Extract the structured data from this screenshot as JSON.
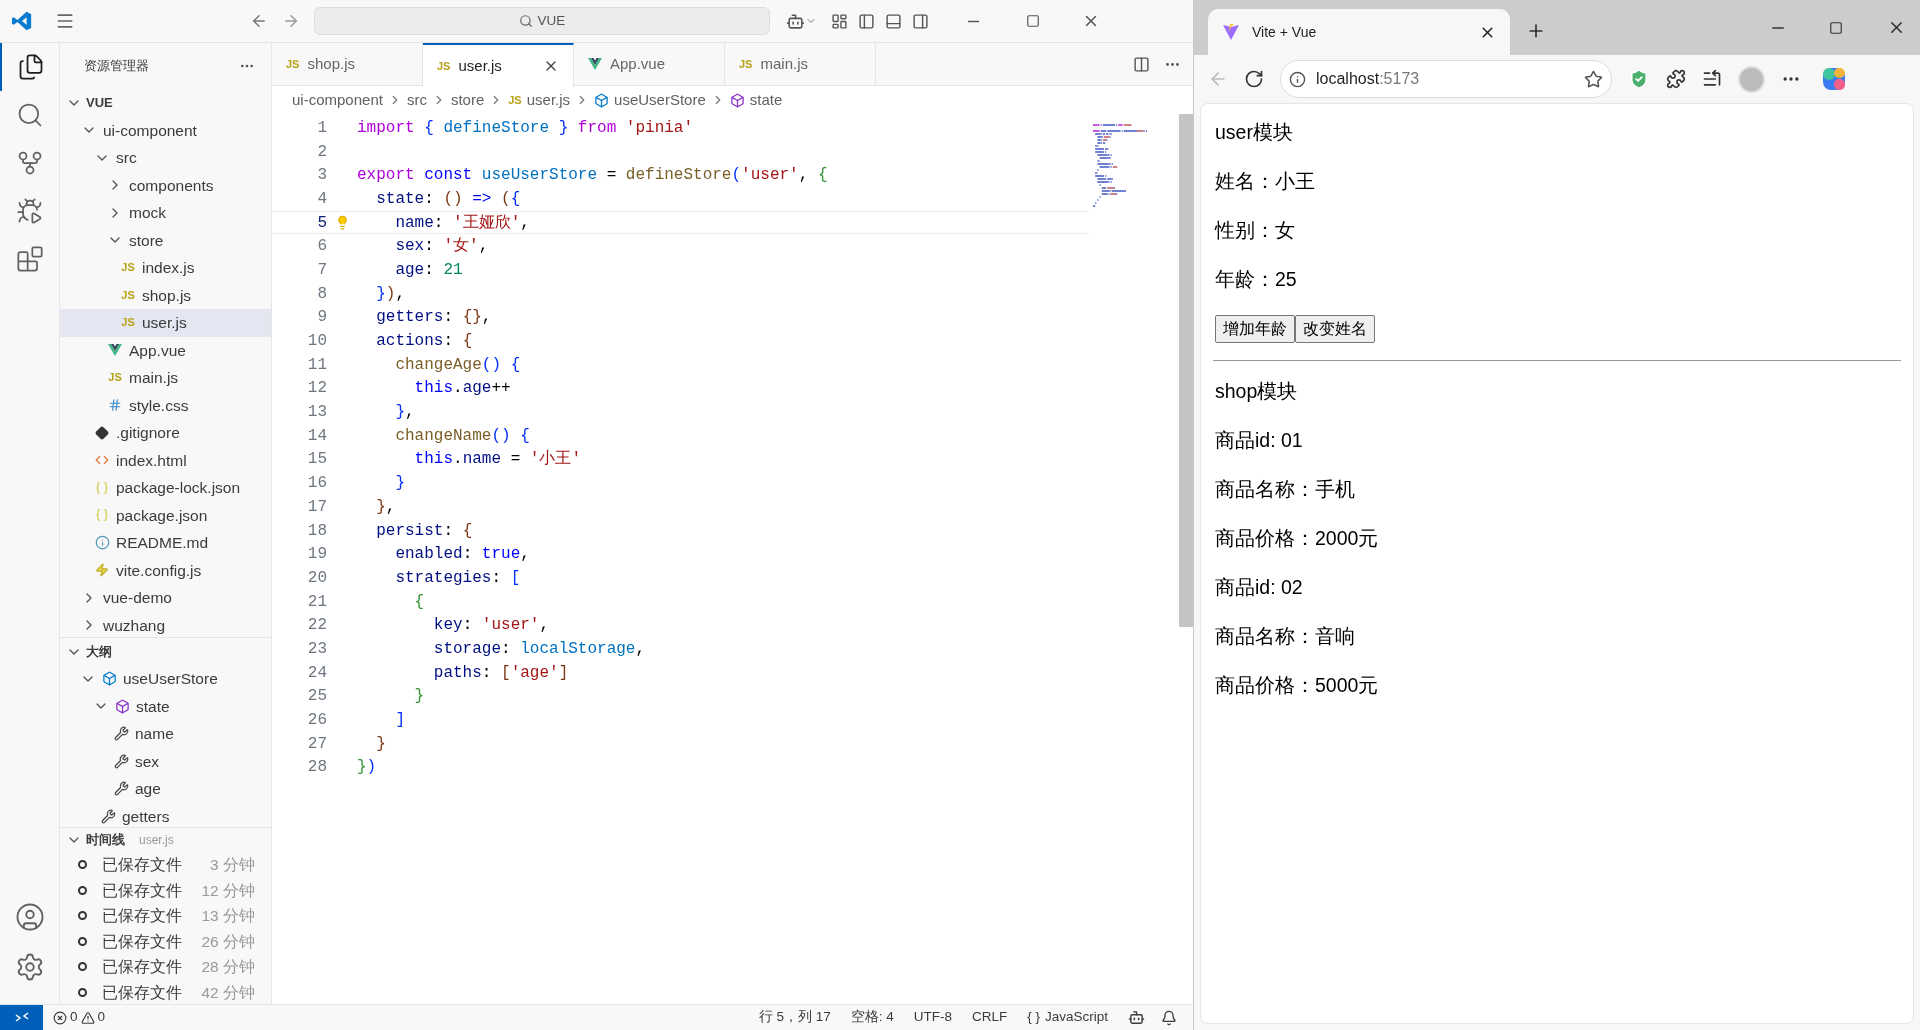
{
  "vscode": {
    "title_search": "VUE",
    "explorer": {
      "title": "资源管理器",
      "root": {
        "label": "VUE",
        "expanded": true,
        "children": [
          {
            "label": "ui-component",
            "kind": "folder",
            "expanded": true,
            "selected": false,
            "children": [
              {
                "label": "src",
                "kind": "folder",
                "expanded": true,
                "selected": false,
                "children": [
                  {
                    "label": "components",
                    "kind": "folder",
                    "expanded": false,
                    "selected": false
                  },
                  {
                    "label": "mock",
                    "kind": "folder",
                    "expanded": false,
                    "selected": false
                  },
                  {
                    "label": "store",
                    "kind": "folder",
                    "expanded": true,
                    "selected": false,
                    "children": [
                      {
                        "label": "index.js",
                        "kind": "js",
                        "badge": "JS",
                        "selected": false
                      },
                      {
                        "label": "shop.js",
                        "kind": "js",
                        "badge": "JS",
                        "selected": false
                      },
                      {
                        "label": "user.js",
                        "kind": "js",
                        "badge": "JS",
                        "selected": true
                      }
                    ]
                  },
                  {
                    "label": "App.vue",
                    "kind": "vue",
                    "selected": false
                  },
                  {
                    "label": "main.js",
                    "kind": "js",
                    "badge": "JS",
                    "selected": false
                  },
                  {
                    "label": "style.css",
                    "kind": "css",
                    "selected": false
                  }
                ]
              },
              {
                "label": ".gitignore",
                "kind": "git",
                "selected": false
              },
              {
                "label": "index.html",
                "kind": "html",
                "selected": false
              },
              {
                "label": "package-lock.json",
                "kind": "json",
                "selected": false
              },
              {
                "label": "package.json",
                "kind": "json",
                "selected": false
              },
              {
                "label": "README.md",
                "kind": "info",
                "selected": false
              },
              {
                "label": "vite.config.js",
                "kind": "vite",
                "selected": false
              }
            ]
          },
          {
            "label": "vue-demo",
            "kind": "folder",
            "expanded": false,
            "selected": false
          },
          {
            "label": "wuzhang",
            "kind": "folder",
            "expanded": false,
            "selected": false
          }
        ]
      }
    },
    "outline": {
      "title": "大纲",
      "expanded": true,
      "items": [
        {
          "label": "useUserStore",
          "kind": "variable",
          "expanded": true,
          "children": [
            {
              "label": "state",
              "kind": "object",
              "expanded": true,
              "children": [
                {
                  "label": "name",
                  "kind": "property"
                },
                {
                  "label": "sex",
                  "kind": "property"
                },
                {
                  "label": "age",
                  "kind": "property"
                }
              ]
            },
            {
              "label": "getters",
              "kind": "property"
            }
          ]
        }
      ]
    },
    "timeline": {
      "title": "时间线",
      "file": "user.js",
      "expanded": true,
      "entries": [
        {
          "label": "已保存文件",
          "time": "3 分钟"
        },
        {
          "label": "已保存文件",
          "time": "12 分钟"
        },
        {
          "label": "已保存文件",
          "time": "13 分钟"
        },
        {
          "label": "已保存文件",
          "time": "26 分钟"
        },
        {
          "label": "已保存文件",
          "time": "28 分钟"
        },
        {
          "label": "已保存文件",
          "time": "42 分钟"
        }
      ]
    },
    "tabs": [
      {
        "label": "shop.js",
        "kind": "js",
        "badge": "JS",
        "selected": false
      },
      {
        "label": "user.js",
        "kind": "js",
        "badge": "JS",
        "selected": true
      },
      {
        "label": "App.vue",
        "kind": "vue",
        "selected": false
      },
      {
        "label": "main.js",
        "kind": "js",
        "badge": "JS",
        "selected": false
      }
    ],
    "breadcrumbs": [
      {
        "label": "ui-component",
        "kind": "folder"
      },
      {
        "label": "src",
        "kind": "folder"
      },
      {
        "label": "store",
        "kind": "folder"
      },
      {
        "label": "user.js",
        "kind": "js",
        "badge": "JS"
      },
      {
        "label": "useUserStore",
        "kind": "variable"
      },
      {
        "label": "state",
        "kind": "object"
      }
    ],
    "code": {
      "lines": [
        {
          "number": "1",
          "current": false,
          "tokens": [
            {
              "kind": "control",
              "text": "import"
            },
            {
              "kind": "b1",
              "text": " {"
            },
            {
              "kind": "var",
              "text": " defineStore"
            },
            {
              "kind": "b1",
              "text": " }"
            },
            {
              "kind": "control",
              "text": " from"
            },
            {
              "kind": "str",
              "text": " 'pinia'"
            }
          ]
        },
        {
          "number": "2",
          "current": false
        },
        {
          "number": "3",
          "current": false,
          "tokens": [
            {
              "kind": "control",
              "text": "export"
            },
            {
              "kind": "kw",
              "text": " const"
            },
            {
              "kind": "var",
              "text": " useUserStore"
            },
            {
              "kind": "plain",
              "text": " ="
            },
            {
              "kind": "fn",
              "text": " defineStore"
            },
            {
              "kind": "b1",
              "text": "("
            },
            {
              "kind": "str",
              "text": "'user'"
            },
            {
              "kind": "plain",
              "text": ","
            },
            {
              "kind": "b2",
              "text": " {"
            }
          ]
        },
        {
          "number": "4",
          "current": false,
          "tokens": [
            {
              "kind": "prop",
              "text": "  state"
            },
            {
              "kind": "plain",
              "text": ":"
            },
            {
              "kind": "b3",
              "text": " ()"
            },
            {
              "kind": "kw",
              "text": " =>"
            },
            {
              "kind": "b3",
              "text": " ("
            },
            {
              "kind": "b1",
              "text": "{"
            }
          ]
        },
        {
          "number": "5",
          "current": true,
          "tokens": [
            {
              "kind": "prop",
              "text": "    name"
            },
            {
              "kind": "plain",
              "text": ":"
            },
            {
              "kind": "str",
              "text": " '王娅欣'"
            },
            {
              "kind": "plain",
              "text": ","
            }
          ]
        },
        {
          "number": "6",
          "current": false,
          "tokens": [
            {
              "kind": "prop",
              "text": "    sex"
            },
            {
              "kind": "plain",
              "text": ":"
            },
            {
              "kind": "str",
              "text": " '女'"
            },
            {
              "kind": "plain",
              "text": ","
            }
          ]
        },
        {
          "number": "7",
          "current": false,
          "tokens": [
            {
              "kind": "prop",
              "text": "    age"
            },
            {
              "kind": "plain",
              "text": ":"
            },
            {
              "kind": "num",
              "text": " 21"
            }
          ]
        },
        {
          "number": "8",
          "current": false,
          "tokens": [
            {
              "kind": "b1",
              "text": "  }"
            },
            {
              "kind": "b3",
              "text": ")"
            },
            {
              "kind": "plain",
              "text": ","
            }
          ]
        },
        {
          "number": "9",
          "current": false,
          "tokens": [
            {
              "kind": "prop",
              "text": "  getters"
            },
            {
              "kind": "plain",
              "text": ":"
            },
            {
              "kind": "b3",
              "text": " {}"
            },
            {
              "kind": "plain",
              "text": ","
            }
          ]
        },
        {
          "number": "10",
          "current": false,
          "tokens": [
            {
              "kind": "prop",
              "text": "  actions"
            },
            {
              "kind": "plain",
              "text": ":"
            },
            {
              "kind": "b3",
              "text": " {"
            }
          ]
        },
        {
          "number": "11",
          "current": false,
          "tokens": [
            {
              "kind": "fn",
              "text": "    changeAge"
            },
            {
              "kind": "b1",
              "text": "()"
            },
            {
              "kind": "b1",
              "text": " {"
            }
          ]
        },
        {
          "number": "12",
          "current": false,
          "tokens": [
            {
              "kind": "kw",
              "text": "      this"
            },
            {
              "kind": "plain",
              "text": "."
            },
            {
              "kind": "prop",
              "text": "age"
            },
            {
              "kind": "plain",
              "text": "++"
            }
          ]
        },
        {
          "number": "13",
          "current": false,
          "tokens": [
            {
              "kind": "b1",
              "text": "    }"
            },
            {
              "kind": "plain",
              "text": ","
            }
          ]
        },
        {
          "number": "14",
          "current": false,
          "tokens": [
            {
              "kind": "fn",
              "text": "    changeName"
            },
            {
              "kind": "b1",
              "text": "()"
            },
            {
              "kind": "b1",
              "text": " {"
            }
          ]
        },
        {
          "number": "15",
          "current": false,
          "tokens": [
            {
              "kind": "kw",
              "text": "      this"
            },
            {
              "kind": "plain",
              "text": "."
            },
            {
              "kind": "prop",
              "text": "name"
            },
            {
              "kind": "plain",
              "text": " ="
            },
            {
              "kind": "str",
              "text": " '小王'"
            }
          ]
        },
        {
          "number": "16",
          "current": false,
          "tokens": [
            {
              "kind": "b1",
              "text": "    }"
            }
          ]
        },
        {
          "number": "17",
          "current": false,
          "tokens": [
            {
              "kind": "b3",
              "text": "  }"
            },
            {
              "kind": "plain",
              "text": ","
            }
          ]
        },
        {
          "number": "18",
          "current": false,
          "tokens": [
            {
              "kind": "prop",
              "text": "  persist"
            },
            {
              "kind": "plain",
              "text": ":"
            },
            {
              "kind": "b3",
              "text": " {"
            }
          ]
        },
        {
          "number": "19",
          "current": false,
          "tokens": [
            {
              "kind": "prop",
              "text": "    enabled"
            },
            {
              "kind": "plain",
              "text": ":"
            },
            {
              "kind": "kw",
              "text": " true"
            },
            {
              "kind": "plain",
              "text": ","
            }
          ]
        },
        {
          "number": "20",
          "current": false,
          "tokens": [
            {
              "kind": "prop",
              "text": "    strategies"
            },
            {
              "kind": "plain",
              "text": ":"
            },
            {
              "kind": "b1",
              "text": " ["
            }
          ]
        },
        {
          "number": "21",
          "current": false,
          "tokens": [
            {
              "kind": "b2",
              "text": "      {"
            }
          ]
        },
        {
          "number": "22",
          "current": false,
          "tokens": [
            {
              "kind": "prop",
              "text": "        key"
            },
            {
              "kind": "plain",
              "text": ":"
            },
            {
              "kind": "str",
              "text": " 'user'"
            },
            {
              "kind": "plain",
              "text": ","
            }
          ]
        },
        {
          "number": "23",
          "current": false,
          "tokens": [
            {
              "kind": "prop",
              "text": "        storage"
            },
            {
              "kind": "plain",
              "text": ":"
            },
            {
              "kind": "var",
              "text": " localStorage"
            },
            {
              "kind": "plain",
              "text": ","
            }
          ]
        },
        {
          "number": "24",
          "current": false,
          "tokens": [
            {
              "kind": "prop",
              "text": "        paths"
            },
            {
              "kind": "plain",
              "text": ":"
            },
            {
              "kind": "b3",
              "text": " ["
            },
            {
              "kind": "str",
              "text": "'age'"
            },
            {
              "kind": "b3",
              "text": "]"
            }
          ]
        },
        {
          "number": "25",
          "current": false,
          "tokens": [
            {
              "kind": "b2",
              "text": "      }"
            }
          ]
        },
        {
          "number": "26",
          "current": false,
          "tokens": [
            {
              "kind": "b1",
              "text": "    ]"
            }
          ]
        },
        {
          "number": "27",
          "current": false,
          "tokens": [
            {
              "kind": "b3",
              "text": "  }"
            }
          ]
        },
        {
          "number": "28",
          "current": false,
          "tokens": [
            {
              "kind": "b2",
              "text": "}"
            },
            {
              "kind": "b1",
              "text": ")"
            }
          ]
        }
      ]
    },
    "status_bar": {
      "errors": "0",
      "warnings": "0",
      "position": "行 5，列 17",
      "indent": "空格: 4",
      "encoding": "UTF-8",
      "eol": "CRLF",
      "language_icon": "{ }",
      "language": "JavaScript"
    }
  },
  "browser": {
    "tab_title": "Vite + Vue",
    "url_host": "localhost",
    "url_port": ":5173",
    "page": [
      {
        "kind": "text",
        "text": "user模块"
      },
      {
        "kind": "text",
        "text": "姓名：小王"
      },
      {
        "kind": "text",
        "text": "性别：女"
      },
      {
        "kind": "text",
        "text": "年龄：25"
      },
      {
        "kind": "buttons",
        "buttons": [
          "增加年龄",
          "改变姓名"
        ]
      },
      {
        "kind": "divider"
      },
      {
        "kind": "text",
        "text": "shop模块"
      },
      {
        "kind": "text",
        "text": "商品id: 01"
      },
      {
        "kind": "text",
        "text": "商品名称：手机"
      },
      {
        "kind": "text",
        "text": "商品价格：2000元"
      },
      {
        "kind": "text",
        "text": "商品id: 02"
      },
      {
        "kind": "text",
        "text": "商品名称：音响"
      },
      {
        "kind": "text",
        "text": "商品价格：5000元"
      }
    ]
  }
}
